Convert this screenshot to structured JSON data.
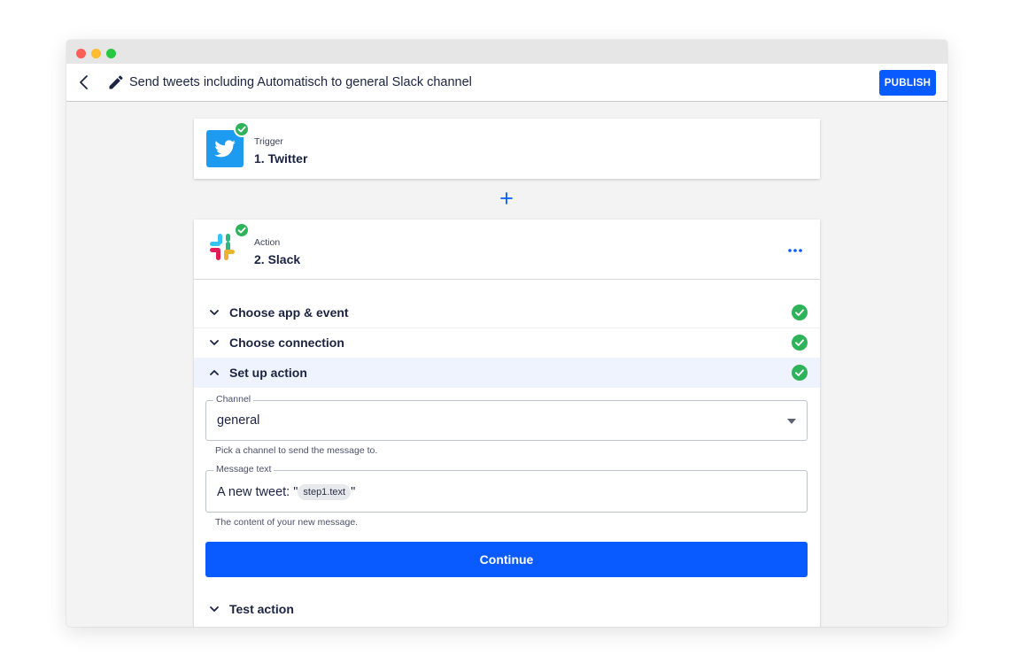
{
  "header": {
    "title": "Send tweets including Automatisch to general Slack channel",
    "publish_label": "PUBLISH"
  },
  "trigger": {
    "kicker": "Trigger",
    "name": "1. Twitter",
    "icon": "twitter-icon",
    "status": "completed"
  },
  "action": {
    "kicker": "Action",
    "name": "2. Slack",
    "icon": "slack-icon",
    "status": "completed",
    "sections": [
      {
        "label": "Choose app & event",
        "expanded": false,
        "completed": true
      },
      {
        "label": "Choose connection",
        "expanded": false,
        "completed": true
      },
      {
        "label": "Set up action",
        "expanded": true,
        "completed": true
      },
      {
        "label": "Test action",
        "expanded": false,
        "completed": false
      }
    ],
    "channel": {
      "label": "Channel",
      "value": "general",
      "help": "Pick a channel to send the message to."
    },
    "message": {
      "label": "Message text",
      "prefix": "A new tweet: \"",
      "token": "step1.text",
      "suffix": "\"",
      "help": "The content of your new message."
    },
    "continue_label": "Continue"
  },
  "colors": {
    "primary": "#0a5bff",
    "success": "#2fb35a",
    "active_section": "#eef3fd",
    "text": "#1b2341"
  }
}
